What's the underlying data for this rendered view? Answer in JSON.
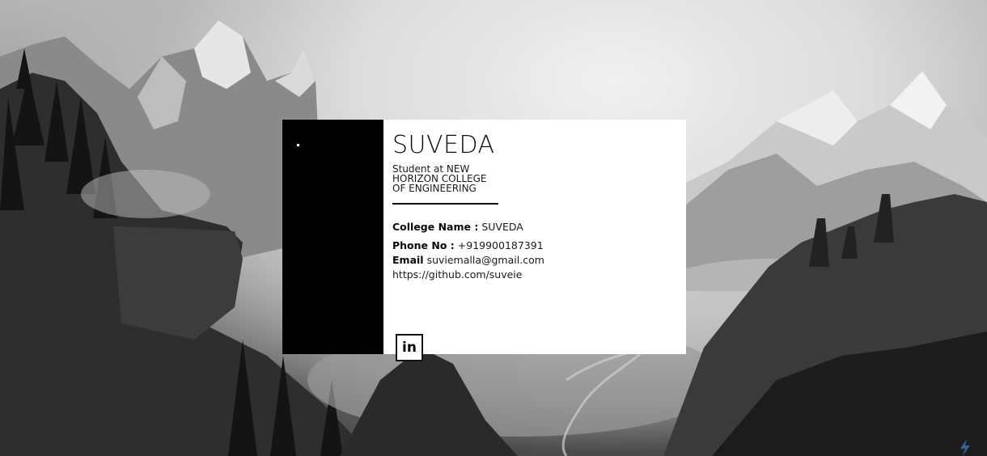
{
  "profile": {
    "name": "SUVEDA",
    "tagline": "Student at NEW HORIZON COLLEGE OF ENGINEERING",
    "college_label": "College Name :",
    "college_value": "SUVEDA",
    "phone_label": "Phone No :",
    "phone_value": "+919900187391",
    "email_label": "Email",
    "email_value": "suviemalla@gmail.com",
    "github_url": "https://github.com/suveie"
  },
  "social": {
    "linkedin_label": "in"
  },
  "colors": {
    "card_background": "#ffffff",
    "photo_panel": "#000000",
    "text": "#111111"
  }
}
